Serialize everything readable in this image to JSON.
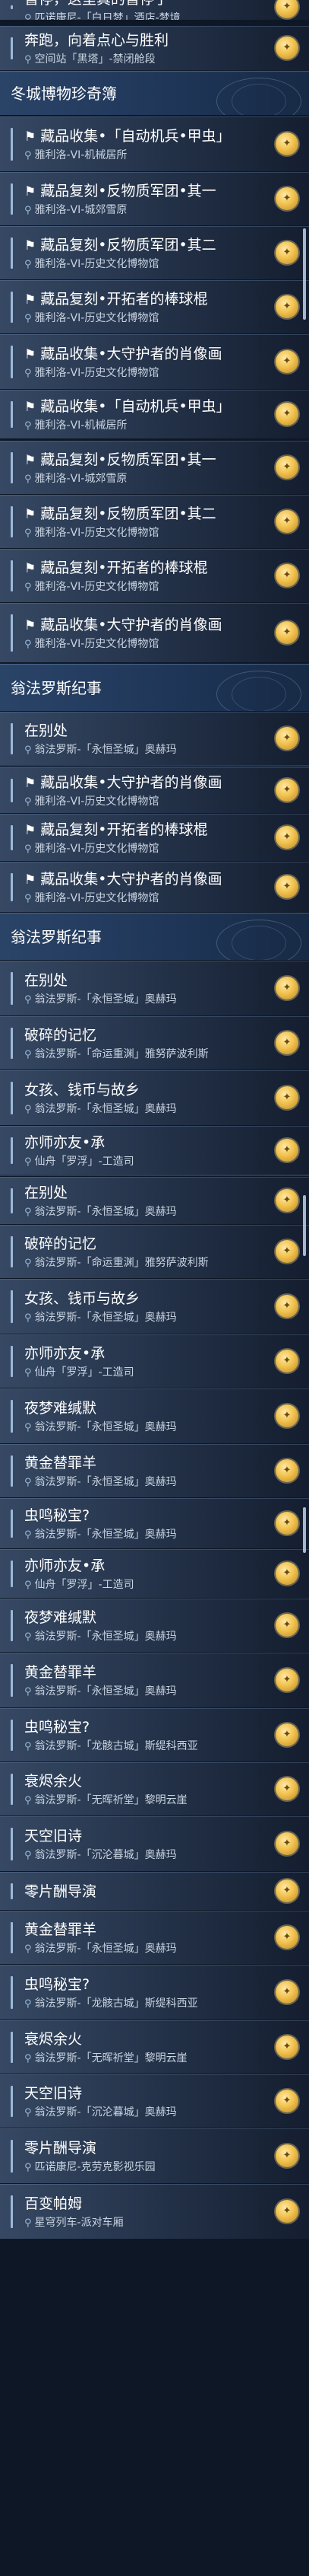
{
  "strings": {
    "t_zanhu": "暂停，这里真的暂停了",
    "t_benpao": "奔跑，向着点心与胜利",
    "t_zidong": "藏品收集•「自动机兵•甲虫」",
    "t_fuke1": "藏品复刻•反物质军团•其一",
    "t_fuke2": "藏品复刻•反物质军团•其二",
    "t_fuke_bang": "藏品复刻•开拓者的棒球棍",
    "t_shouhu": "藏品收集•大守护者的肖像画",
    "t_biechu": "在别处",
    "t_posui": "破碎的记忆",
    "t_nvhai": "女孩、钱币与故乡",
    "t_yishi": "亦师亦友•承",
    "t_yemeng": "夜梦难缄默",
    "t_huangjin": "黄金替罪羊",
    "t_chongming": "虫鸣秘宝?",
    "t_shuaijin": "衰烬余火",
    "t_tiankong": "天空旧诗",
    "t_lingpian": "零片酬导演",
    "t_baibian": "百变帕姆",
    "l_baixue": "匹诺康尼-「白日梦」酒店-梦境",
    "l_kongzhan": "空间站「黑塔」-禁闭舱段",
    "l_jixie": "雅利洛-VI-机械居所",
    "l_chengbao": "雅利洛-VI-城郊雪原",
    "l_bowu": "雅利洛-VI-历史文化博物馆",
    "l_yongheng": "翁法罗斯-「永恒圣城」奥赫玛",
    "l_mingyun": "翁法罗斯-「命运重渊」雅努萨波利斯",
    "l_xianzhou": "仙舟「罗浮」-工造司",
    "l_longgu": "翁法罗斯-「龙骸古城」斯缇科西亚",
    "l_wuhui": "翁法罗斯-「无晖祈堂」黎明云崖",
    "l_chenlun": "翁法罗斯-「沉沦暮城」奥赫玛",
    "l_kesi": "匹诺康尼-克劳克影视乐园",
    "l_xingqiong": "星穹列车-派对车厢",
    "h_dongcheng": "冬城博物珍奇簿",
    "h_wengfa": "翁法罗斯纪事"
  },
  "icons": {
    "pin": "location-pin-icon",
    "medal": "achievement-medal-icon",
    "flag": "quest-flag-icon"
  },
  "colors": {
    "background": "#0d1726",
    "row": "#2d3f5c",
    "header": "#24406a",
    "accent": "#9bb8d8",
    "medal": "#f1c24d"
  }
}
